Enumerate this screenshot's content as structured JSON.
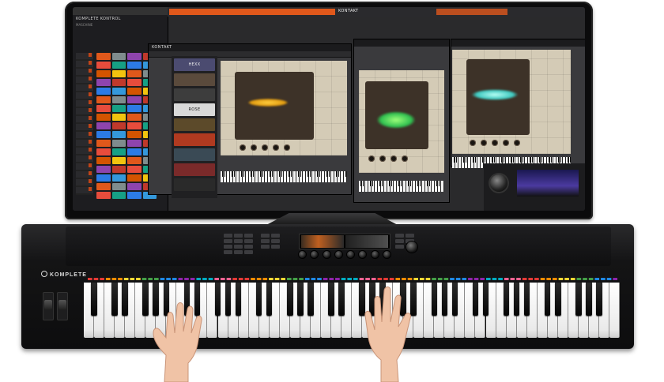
{
  "monitor": {
    "host_title": "KOMPLETE KONTROL",
    "host_subtitle": "MASCHINE",
    "kontakt_title_1": "KONTAKT",
    "kontakt_title_2": "KONTAKT",
    "colors": {
      "accent_orange": "#e0581b",
      "instrument_beige": "#d4cbb6",
      "panel_brown": "#3d3228"
    },
    "browser_tiles": [
      {
        "label": "HEXX",
        "color": "#4b4b70"
      },
      {
        "label": "",
        "color": "#5a4a3c"
      },
      {
        "label": "",
        "color": "#3d3d3d"
      },
      {
        "label": "ROSE",
        "color": "#d9d9d9"
      },
      {
        "label": "",
        "color": "#5c4a2a"
      },
      {
        "label": "",
        "color": "#b03a20"
      },
      {
        "label": "",
        "color": "#3a4a55"
      },
      {
        "label": "",
        "color": "#7a2a2a"
      },
      {
        "label": "",
        "color": "#2a2a2a"
      }
    ]
  },
  "keyboard": {
    "brand": "KOMPLETE",
    "light_colors": [
      "#e53935",
      "#fb8c00",
      "#fdd835",
      "#43a047",
      "#1e88e5",
      "#8e24aa",
      "#00acc1",
      "#f06292"
    ]
  },
  "icons": {
    "monitor": "monitor-screen",
    "knob": "rotary-knob",
    "hand": "hand"
  }
}
